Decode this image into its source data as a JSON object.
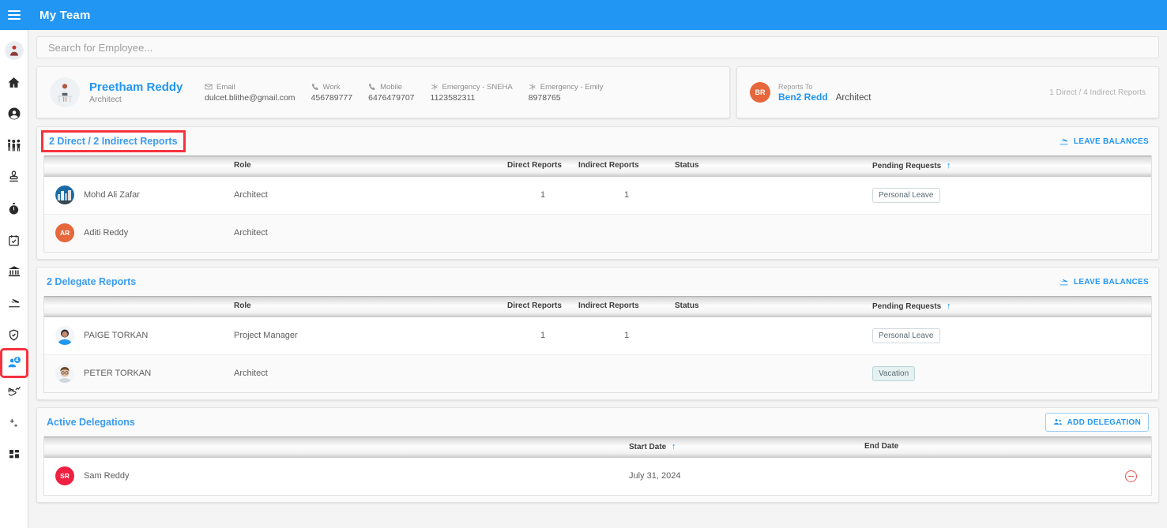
{
  "colors": {
    "brand_blue": "#2196f3",
    "link_blue": "#3a9cf0",
    "highlight_red": "#f5333f",
    "avatar_orange": "#e5673b",
    "avatar_red": "#ef2040",
    "danger_red": "#ef5350"
  },
  "topbar": {
    "title": "My Team",
    "menu_icon": "hamburger-icon"
  },
  "sidebar": {
    "items": [
      {
        "name": "user-avatar",
        "icon": "user-avatar-icon",
        "glyph": "👩‍💻",
        "selected": false,
        "badge": ""
      },
      {
        "name": "home",
        "icon": "home-icon",
        "selected": false,
        "badge": ""
      },
      {
        "name": "profile",
        "icon": "person-circle-icon",
        "selected": false,
        "badge": ""
      },
      {
        "name": "people",
        "icon": "family-people-icon",
        "selected": false,
        "badge": ""
      },
      {
        "name": "onboarding",
        "icon": "stamp-icon",
        "selected": false,
        "badge": ""
      },
      {
        "name": "time-tracking",
        "icon": "stopwatch-icon",
        "selected": false,
        "badge": ""
      },
      {
        "name": "timesheet",
        "icon": "calendar-check-icon",
        "selected": false,
        "badge": ""
      },
      {
        "name": "payroll",
        "icon": "bank-icon",
        "selected": false,
        "badge": ""
      },
      {
        "name": "leave",
        "icon": "airplane-landing-icon",
        "selected": false,
        "badge": ""
      },
      {
        "name": "benefits",
        "icon": "shield-check-icon",
        "selected": false,
        "badge": ""
      },
      {
        "name": "my-team",
        "icon": "person-add-icon",
        "selected": true,
        "badge": "4"
      },
      {
        "name": "performance",
        "icon": "hand-chart-icon",
        "selected": false,
        "badge": ""
      },
      {
        "name": "recruitment",
        "icon": "person-plus-icon",
        "selected": false,
        "badge": ""
      },
      {
        "name": "dashboard",
        "icon": "grid-apps-icon",
        "selected": false,
        "badge": ""
      }
    ]
  },
  "search": {
    "placeholder": "Search for Employee...",
    "value": "",
    "name": "search-input"
  },
  "profile": {
    "avatar_glyph": "👩‍💻",
    "name": "Preetham Reddy",
    "role": "Architect",
    "fields": [
      {
        "icon": "email-icon",
        "label": "Email",
        "value": "dulcet.blithe@gmail.com"
      },
      {
        "icon": "phone-icon",
        "label": "Work",
        "value": "456789777"
      },
      {
        "icon": "phone-icon",
        "label": "Mobile",
        "value": "6476479707"
      },
      {
        "icon": "emergency-icon",
        "label": "Emergency - SNEHA",
        "value": "1123582311"
      },
      {
        "icon": "emergency-icon",
        "label": "Emergency - Emily",
        "value": "8978765"
      }
    ]
  },
  "reports_to": {
    "initials": "BR",
    "label": "Reports To",
    "name": "Ben2 Redd",
    "role": "Architect",
    "counts": "1 Direct / 4 Indirect Reports"
  },
  "sections": {
    "direct_reports": {
      "title": "2 Direct / 2 Indirect Reports",
      "highlighted": true,
      "action": {
        "label": "LEAVE BALANCES",
        "icon": "airplane-landing-icon"
      },
      "columns": [
        "",
        "Role",
        "Direct Reports",
        "Indirect Reports",
        "Status",
        "Pending Requests"
      ],
      "sorted_column": "Pending Requests",
      "sort_direction": "asc",
      "rows": [
        {
          "avatar_type": "emoji",
          "avatar": "🏙️",
          "avatar_color": "#f0f3f6",
          "name": "Mohd Ali Zafar",
          "role": "Architect",
          "direct": "1",
          "indirect": "1",
          "status": "",
          "pending": "Personal Leave",
          "pending_style": "plain"
        },
        {
          "avatar_type": "initials",
          "avatar": "AR",
          "avatar_color": "#e5673b",
          "name": "Aditi Reddy",
          "role": "Architect",
          "direct": "",
          "indirect": "",
          "status": "",
          "pending": "",
          "pending_style": ""
        }
      ]
    },
    "delegate_reports": {
      "title": "2 Delegate Reports",
      "highlighted": false,
      "action": {
        "label": "LEAVE BALANCES",
        "icon": "airplane-landing-icon"
      },
      "columns": [
        "",
        "Role",
        "Direct Reports",
        "Indirect Reports",
        "Status",
        "Pending Requests"
      ],
      "sorted_column": "Pending Requests",
      "sort_direction": "asc",
      "rows": [
        {
          "avatar_type": "emoji",
          "avatar": "👩",
          "avatar_color": "#2196f3",
          "name": "PAIGE TORKAN",
          "role": "Project Manager",
          "direct": "1",
          "indirect": "1",
          "status": "",
          "pending": "Personal Leave",
          "pending_style": "plain"
        },
        {
          "avatar_type": "emoji",
          "avatar": "👨",
          "avatar_color": "#f0f3f6",
          "name": "PETER TORKAN",
          "role": "Architect",
          "direct": "",
          "indirect": "",
          "status": "",
          "pending": "Vacation",
          "pending_style": "teal"
        }
      ]
    },
    "active_delegations": {
      "title": "Active Delegations",
      "action": {
        "label": "ADD DELEGATION",
        "icon": "add-people-icon"
      },
      "columns": [
        "",
        "Start Date",
        "End Date",
        ""
      ],
      "sorted_column": "Start Date",
      "sort_direction": "asc",
      "rows": [
        {
          "avatar_type": "initials",
          "avatar": "SR",
          "avatar_color": "#ef2040",
          "name": "Sam Reddy",
          "start_date": "July 31, 2024",
          "end_date": "",
          "remove_icon": "remove-circle-icon"
        }
      ]
    }
  }
}
